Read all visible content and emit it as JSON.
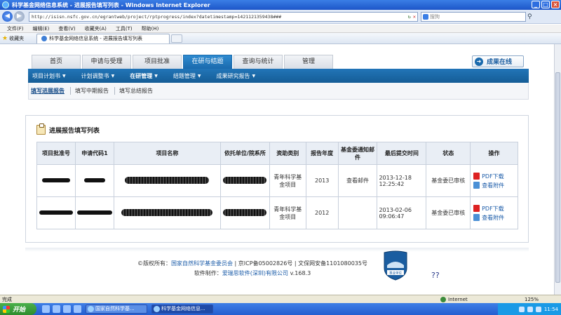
{
  "window": {
    "title": "科学基金网络信息系统 - 进展报告填写列表 - Windows Internet Explorer"
  },
  "browser": {
    "address": "http://isisn.nsfc.gov.cn/egrantweb/project/rptprogress/index?datetimestamp=1421121359438###",
    "search_placeholder": "搜狗",
    "menu": [
      "文件(F)",
      "编辑(E)",
      "查看(V)",
      "收藏夹(A)",
      "工具(T)",
      "帮助(H)"
    ],
    "favorites_label": "收藏夹",
    "tab_title": "科学基金网络信息系统 - 进展报告填写列表",
    "status_text": "完成",
    "zone": "Internet",
    "zoom": "125%"
  },
  "nav": {
    "tabs": [
      "首页",
      "申请与受理",
      "项目批准",
      "在研与结题",
      "查询与统计",
      "管理"
    ],
    "active_index": 3,
    "online_button": "成果在线"
  },
  "subnav": {
    "items": [
      "项目计划书",
      "计划调整书",
      "在研管理",
      "结题管理",
      "成果研究报告"
    ],
    "active_index": 2
  },
  "subsubnav": {
    "items": [
      "填写进展报告",
      "填写中期报告",
      "填写总结报告"
    ],
    "active_index": 0
  },
  "panel": {
    "title": "进展报告填写列表"
  },
  "table": {
    "headers": [
      "项目批准号",
      "申请代码1",
      "项目名称",
      "依托单位/院系所",
      "资助类别",
      "报告年度",
      "基金委通知邮件",
      "最后提交时间",
      "状态",
      "操作"
    ],
    "rows": [
      {
        "category": "青年科学基金项目",
        "year": "2013",
        "mail": "查看邮件",
        "submit_time": "2013-12-18 12:25:42",
        "status": "基金委已审核",
        "ops": [
          "PDF下载",
          "查看附件"
        ]
      },
      {
        "category": "青年科学基金项目",
        "year": "2012",
        "mail": "",
        "submit_time": "2013-02-06 09:06:47",
        "status": "基金委已审核",
        "ops": [
          "PDF下载",
          "查看附件"
        ]
      }
    ]
  },
  "stray_text": "??",
  "footer": {
    "line1_prefix": "©版权所有：",
    "line1_link": "国家自然科学基金委员会",
    "line1_rest": " | 京ICP备05002826号 | 文保网安备1101080035号",
    "line2_prefix": "软件制作：",
    "line2_link": "爱瑞思软件(深圳)有限公司",
    "line2_rest": " v.168.3",
    "badge_text": "事业单位"
  },
  "taskbar": {
    "start": "开始",
    "items": [
      "国家自然科学基...",
      "科学基金网络信息..."
    ],
    "clock": "11:54"
  }
}
